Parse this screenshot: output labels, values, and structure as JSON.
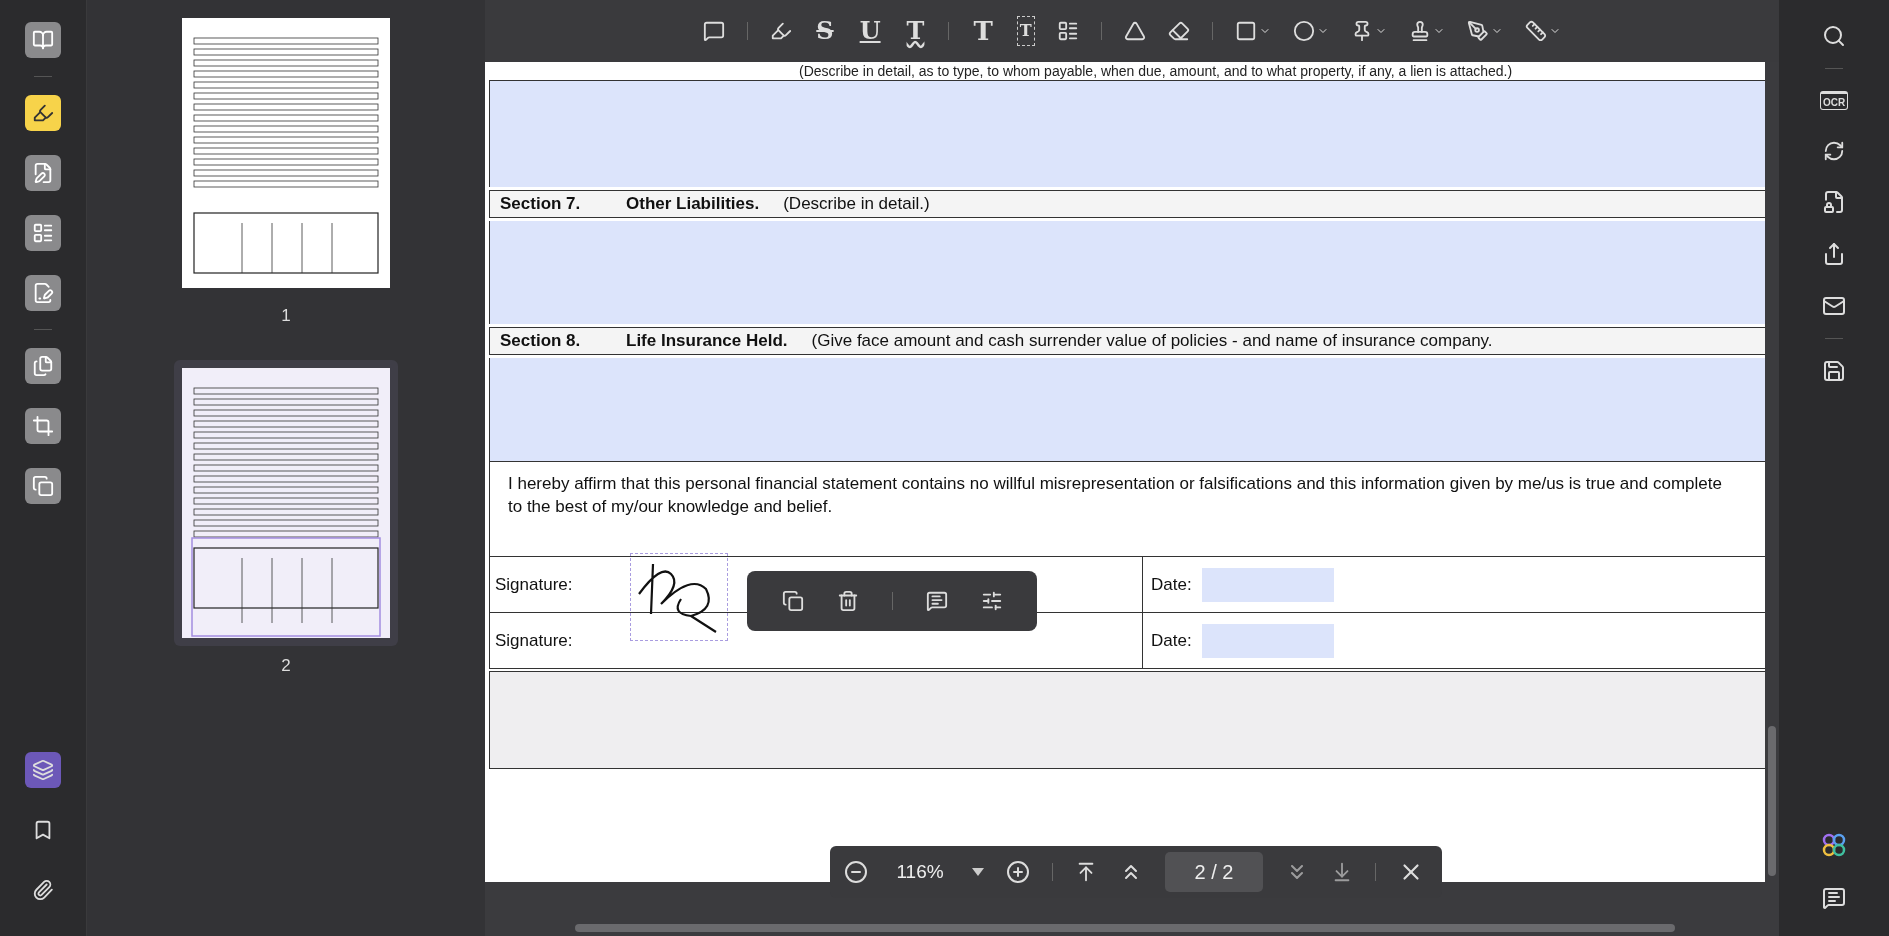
{
  "left_rail": {
    "tools": [
      {
        "selected": false
      },
      {
        "selected": true
      },
      {
        "selected": false
      },
      {
        "selected": false
      },
      {
        "selected": false
      },
      {
        "selected": false
      },
      {
        "selected": false
      },
      {
        "selected": false
      }
    ],
    "bottom_tools": [
      {
        "selected": true
      },
      {
        "selected": false
      },
      {
        "selected": false
      }
    ]
  },
  "thumbnails": [
    {
      "label": "1",
      "selected": false
    },
    {
      "label": "2",
      "selected": true
    }
  ],
  "toolbar": {
    "glyph_tools": [
      {
        "kind": "strike",
        "glyph": "S"
      },
      {
        "kind": "underline",
        "glyph": "U"
      },
      {
        "kind": "squiggly",
        "glyph": "T"
      },
      {
        "kind": "text",
        "glyph": "T"
      },
      {
        "kind": "textbox",
        "glyph": "T"
      }
    ]
  },
  "document": {
    "cut_note": "(Describe in detail, as to type, to whom payable, when due, amount, and to what property, if any, a lien is attached.)",
    "sections": [
      {
        "number": "Section 7.",
        "title": "Other Liabilities.",
        "note": "(Describe in detail.)"
      },
      {
        "number": "Section 8.",
        "title": "Life Insurance Held.",
        "note": "(Give face amount and cash surrender value of policies - and name of insurance company."
      }
    ],
    "affirmation": "I hereby affirm that this personal financial statement contains no willful misrepresentation or falsifications and this information given by me/us is true and complete to the best of my/our knowledge and belief.",
    "signature_rows": [
      {
        "label": "Signature:",
        "date_label": "Date:",
        "signed": true
      },
      {
        "label": "Signature:",
        "date_label": "Date:",
        "signed": false
      }
    ]
  },
  "bottom_bar": {
    "zoom": "116%",
    "page": "2 / 2"
  },
  "right_panel": {
    "ocr_label": "OCR"
  }
}
